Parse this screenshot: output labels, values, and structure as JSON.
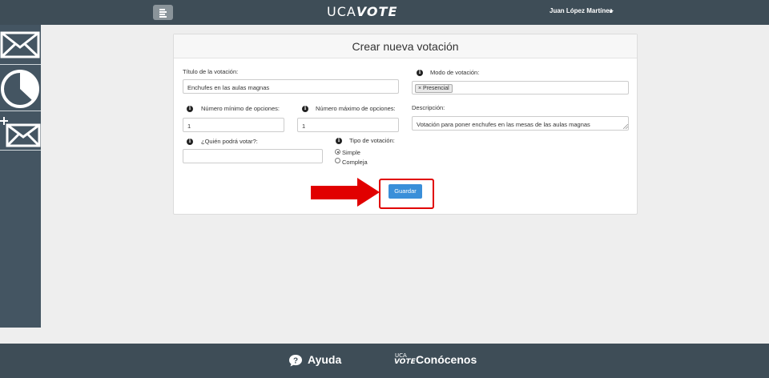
{
  "header": {
    "brand_part1": "UCA",
    "brand_part2": "VOTE",
    "user_name": "Juan López Martínez",
    "icons": [
      "menu-icon",
      "caret-down-icon"
    ]
  },
  "sidebar": {
    "items": [
      {
        "name": "votations",
        "icon": "envelope-icon"
      },
      {
        "name": "results",
        "icon": "pie-chart-icon"
      },
      {
        "name": "new-votation",
        "icon": "envelope-plus-icon"
      }
    ]
  },
  "form": {
    "title": "Crear nueva votación",
    "titulo_label": "Título de la votación:",
    "titulo_value": "Enchufes en las aulas magnas",
    "modo_label": "Modo de votación:",
    "modo_tags": [
      {
        "remove": "×",
        "label": "Presencial"
      }
    ],
    "min_label": "Número mínimo de opciones:",
    "min_value": "1",
    "max_label": "Número máximo de opciones:",
    "max_value": "1",
    "descripcion_label": "Descripción:",
    "descripcion_value": "Votación para poner enchufes en las mesas de las aulas magnas",
    "quien_label": "¿Quién podrá votar?:",
    "quien_value": "",
    "tipo_label": "Tipo de votación:",
    "tipo_options": [
      {
        "label": "Simple",
        "checked": true
      },
      {
        "label": "Compleja",
        "checked": false
      }
    ],
    "save_label": "Guardar",
    "info_icon": "info-icon"
  },
  "annotation": {
    "arrow_color": "#e10000",
    "box_color": "#e10000"
  },
  "footer": {
    "help_label": "Ayuda",
    "logo_top": "UCA",
    "logo_bottom": "VOTE",
    "about_label": "Conócenos"
  },
  "colors": {
    "topbar": "#3e4d57",
    "sidebar": "#445562",
    "primary_button": "#3a8fd9",
    "background": "#eeeeee"
  }
}
